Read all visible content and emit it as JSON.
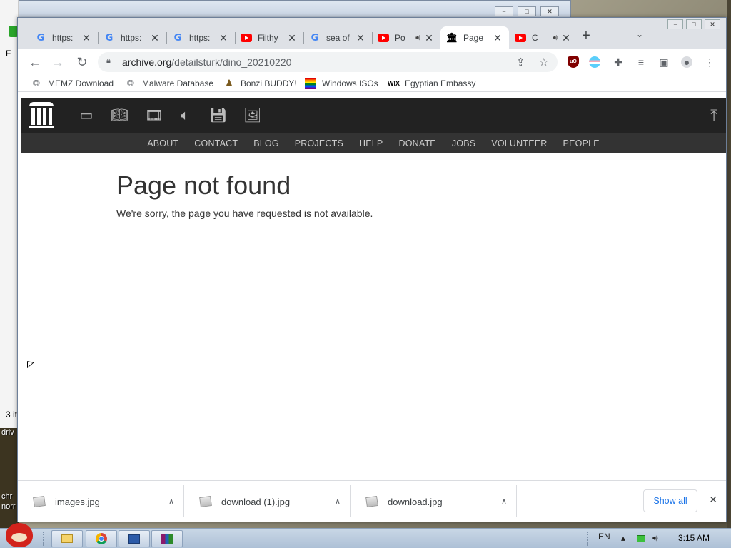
{
  "background": {
    "window_ctrls": [
      "−",
      "□",
      "✕"
    ],
    "side_text": [
      "F",
      "3 it"
    ],
    "desktop_labels": [
      "driv",
      "chr",
      "norr"
    ]
  },
  "browser": {
    "window_ctrls": [
      "−",
      "□",
      "✕"
    ],
    "tabs": [
      {
        "title": "https:",
        "favicon": "google-icon",
        "audio": false,
        "active": false
      },
      {
        "title": "https:",
        "favicon": "google-icon",
        "audio": false,
        "active": false
      },
      {
        "title": "https:",
        "favicon": "google-icon",
        "audio": false,
        "active": false
      },
      {
        "title": "Filthy",
        "favicon": "youtube-icon",
        "audio": false,
        "active": false
      },
      {
        "title": "sea of",
        "favicon": "google-icon",
        "audio": false,
        "active": false
      },
      {
        "title": "Po",
        "favicon": "youtube-icon",
        "audio": true,
        "active": false
      },
      {
        "title": "Page",
        "favicon": "archive-icon",
        "audio": false,
        "active": true
      },
      {
        "title": "C",
        "favicon": "youtube-icon",
        "audio": true,
        "active": false
      }
    ],
    "omnibox": {
      "host": "archive.org",
      "path": "/detailsturk/dino_20210220"
    },
    "bookmarks": [
      {
        "label": "MEMZ Download",
        "icon": "globe-icon"
      },
      {
        "label": "Malware Database",
        "icon": "globe-icon"
      },
      {
        "label": "Bonzi BUDDY!",
        "icon": "bonzi-icon"
      },
      {
        "label": "Windows ISOs",
        "icon": "rainbow-flag-icon"
      },
      {
        "label": "Egyptian Embassy",
        "icon": "wix-icon"
      }
    ]
  },
  "page": {
    "nav": [
      "ABOUT",
      "CONTACT",
      "BLOG",
      "PROJECTS",
      "HELP",
      "DONATE",
      "JOBS",
      "VOLUNTEER",
      "PEOPLE"
    ],
    "error_title": "Page not found",
    "error_message": "We're sorry, the page you have requested is not available."
  },
  "downloads": {
    "items": [
      {
        "name": "images.jpg"
      },
      {
        "name": "download (1).jpg"
      },
      {
        "name": "download.jpg"
      }
    ],
    "show_all_label": "Show all"
  },
  "taskbar": {
    "language": "EN",
    "clock": "3:15 AM"
  }
}
